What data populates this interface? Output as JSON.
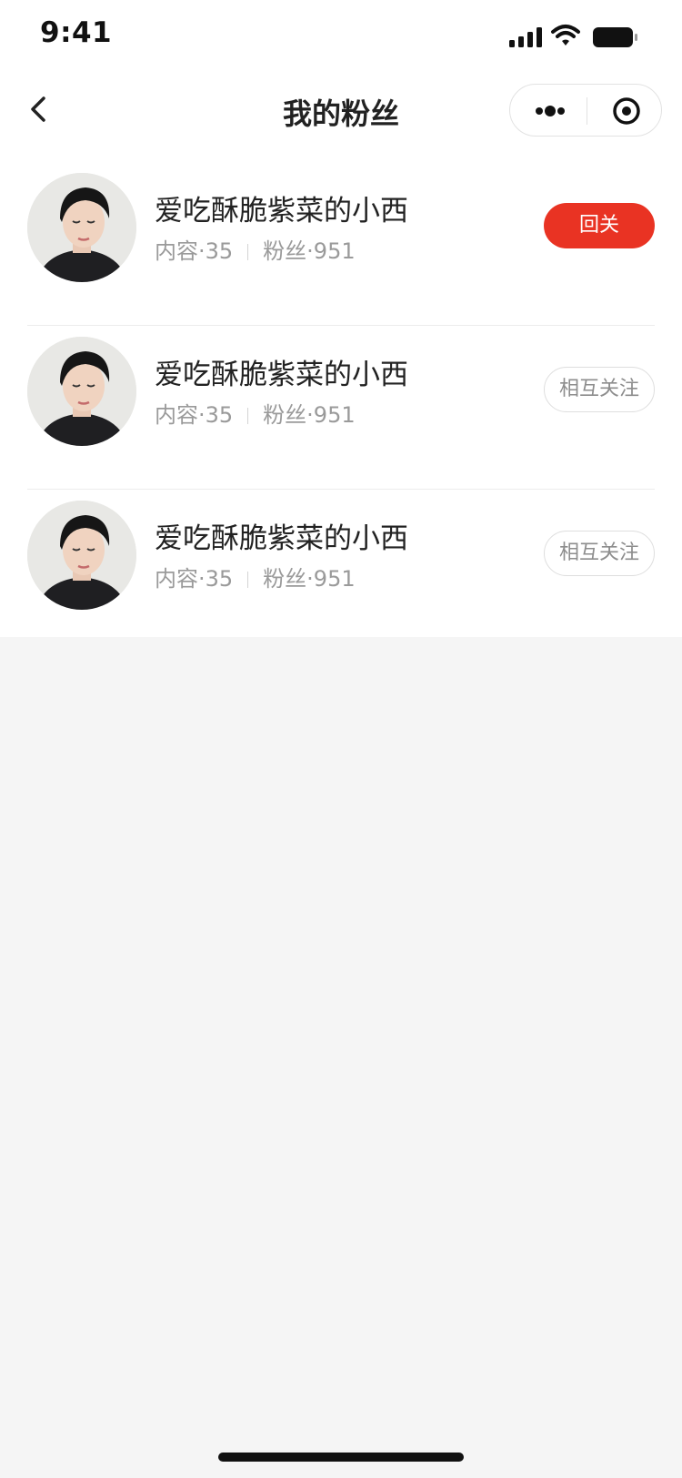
{
  "status_bar": {
    "time": "9:41"
  },
  "nav": {
    "title": "我的粉丝",
    "back_icon": "chevron-left-icon",
    "more_icon": "more-dots-icon",
    "close_icon": "target-close-icon"
  },
  "fans": [
    {
      "name": "爱吃酥脆紫菜的小西",
      "content_label": "内容·35",
      "fans_label": "粉丝·951",
      "button": "回关",
      "button_style": "primary"
    },
    {
      "name": "爱吃酥脆紫菜的小西",
      "content_label": "内容·35",
      "fans_label": "粉丝·951",
      "button": "相互关注",
      "button_style": "outline"
    },
    {
      "name": "爱吃酥脆紫菜的小西",
      "content_label": "内容·35",
      "fans_label": "粉丝·951",
      "button": "相互关注",
      "button_style": "outline"
    }
  ],
  "colors": {
    "accent": "#e93323",
    "page_bg": "#f5f5f5",
    "card_bg": "#ffffff"
  }
}
